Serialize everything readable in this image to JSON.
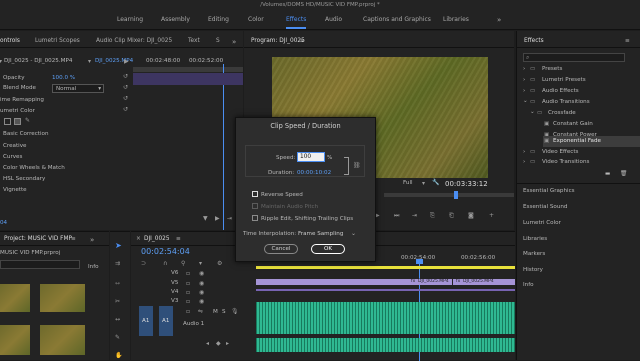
{
  "title_bar": "/Volumes/DOMS HD/MUSIC VID FMP.prproj *",
  "workspaces": [
    "Learning",
    "Assembly",
    "Editing",
    "Color",
    "Effects",
    "Audio",
    "Captions and Graphics",
    "Libraries"
  ],
  "active_workspace": "Effects",
  "source_tabs": {
    "controls": "ontrols",
    "scopes": "Lumetri Scopes",
    "mixer": "Audio Clip Mixer: DJI_0025",
    "text": "Text",
    "more": "S"
  },
  "effect_controls": {
    "clip": "DJI_0025 - DJI_0025.MP4",
    "clip_short": "DJI_0025.MP4",
    "ruler_start": "00:02:48:00",
    "ruler_end": "00:02:52:00",
    "opacity_label": "Opacity",
    "opacity_value": "100.0 %",
    "blend_label": "Blend Mode",
    "blend_value": "Normal",
    "time_remap": "ime Remapping",
    "lumetri": "umetri Color",
    "basic": "Basic Correction",
    "creative": "Creative",
    "curves": "Curves",
    "wheels": "Color Wheels & Match",
    "hsl": "HSL Secondary",
    "vignette": "Vignette",
    "timecode": "04"
  },
  "program": {
    "title": "Program: DJI_0025",
    "full": "Full",
    "timecode": "00:03:33:12"
  },
  "dialog": {
    "title": "Clip Speed / Duration",
    "speed_label": "Speed:",
    "speed_value": "100",
    "percent": "%",
    "duration_label": "Duration:",
    "duration_value": "00:00:10:02",
    "reverse": "Reverse Speed",
    "maintain": "Maintain Audio Pitch",
    "ripple": "Ripple Edit, Shifting Trailing Clips",
    "interp_label": "Time Interpolation:",
    "interp_value": "Frame Sampling",
    "cancel": "Cancel",
    "ok": "OK"
  },
  "project": {
    "tab": "Project: MUSIC VID FMP",
    "file": "MUSIC VID FMP.prproj",
    "info": "Info"
  },
  "timeline": {
    "seq_tab": "DJI_0025",
    "timecode": "00:02:54:04",
    "ruler": [
      "00:02:54:00",
      "00:02:56:00"
    ],
    "v_tracks": [
      "V6",
      "V5",
      "V4",
      "V3"
    ],
    "a_tracks": [
      "A1"
    ],
    "audio_name": "Audio 1",
    "clip_label_1": "DJI_0025.MP4",
    "clip_label_2": "DJI_0025.MP4",
    "fx": "fx",
    "m": "M",
    "s": "S"
  },
  "effects_panel": {
    "tab": "Effects",
    "tree": [
      "Presets",
      "Lumetri Presets",
      "Audio Effects",
      "Audio Transitions",
      "Crossfade",
      "Constant Gain",
      "Constant Power",
      "Exponential Fade",
      "Video Effects",
      "Video Transitions"
    ],
    "selected": "Exponential Fade"
  },
  "side_panels": [
    "Essential Graphics",
    "Essential Sound",
    "Lumetri Color",
    "Libraries",
    "Markers",
    "History",
    "Info"
  ],
  "colors": {
    "accent": "#4b8ef2",
    "audio_clip": "#2fb992",
    "video_clip": "#9d8bc9",
    "panel": "#232323"
  }
}
